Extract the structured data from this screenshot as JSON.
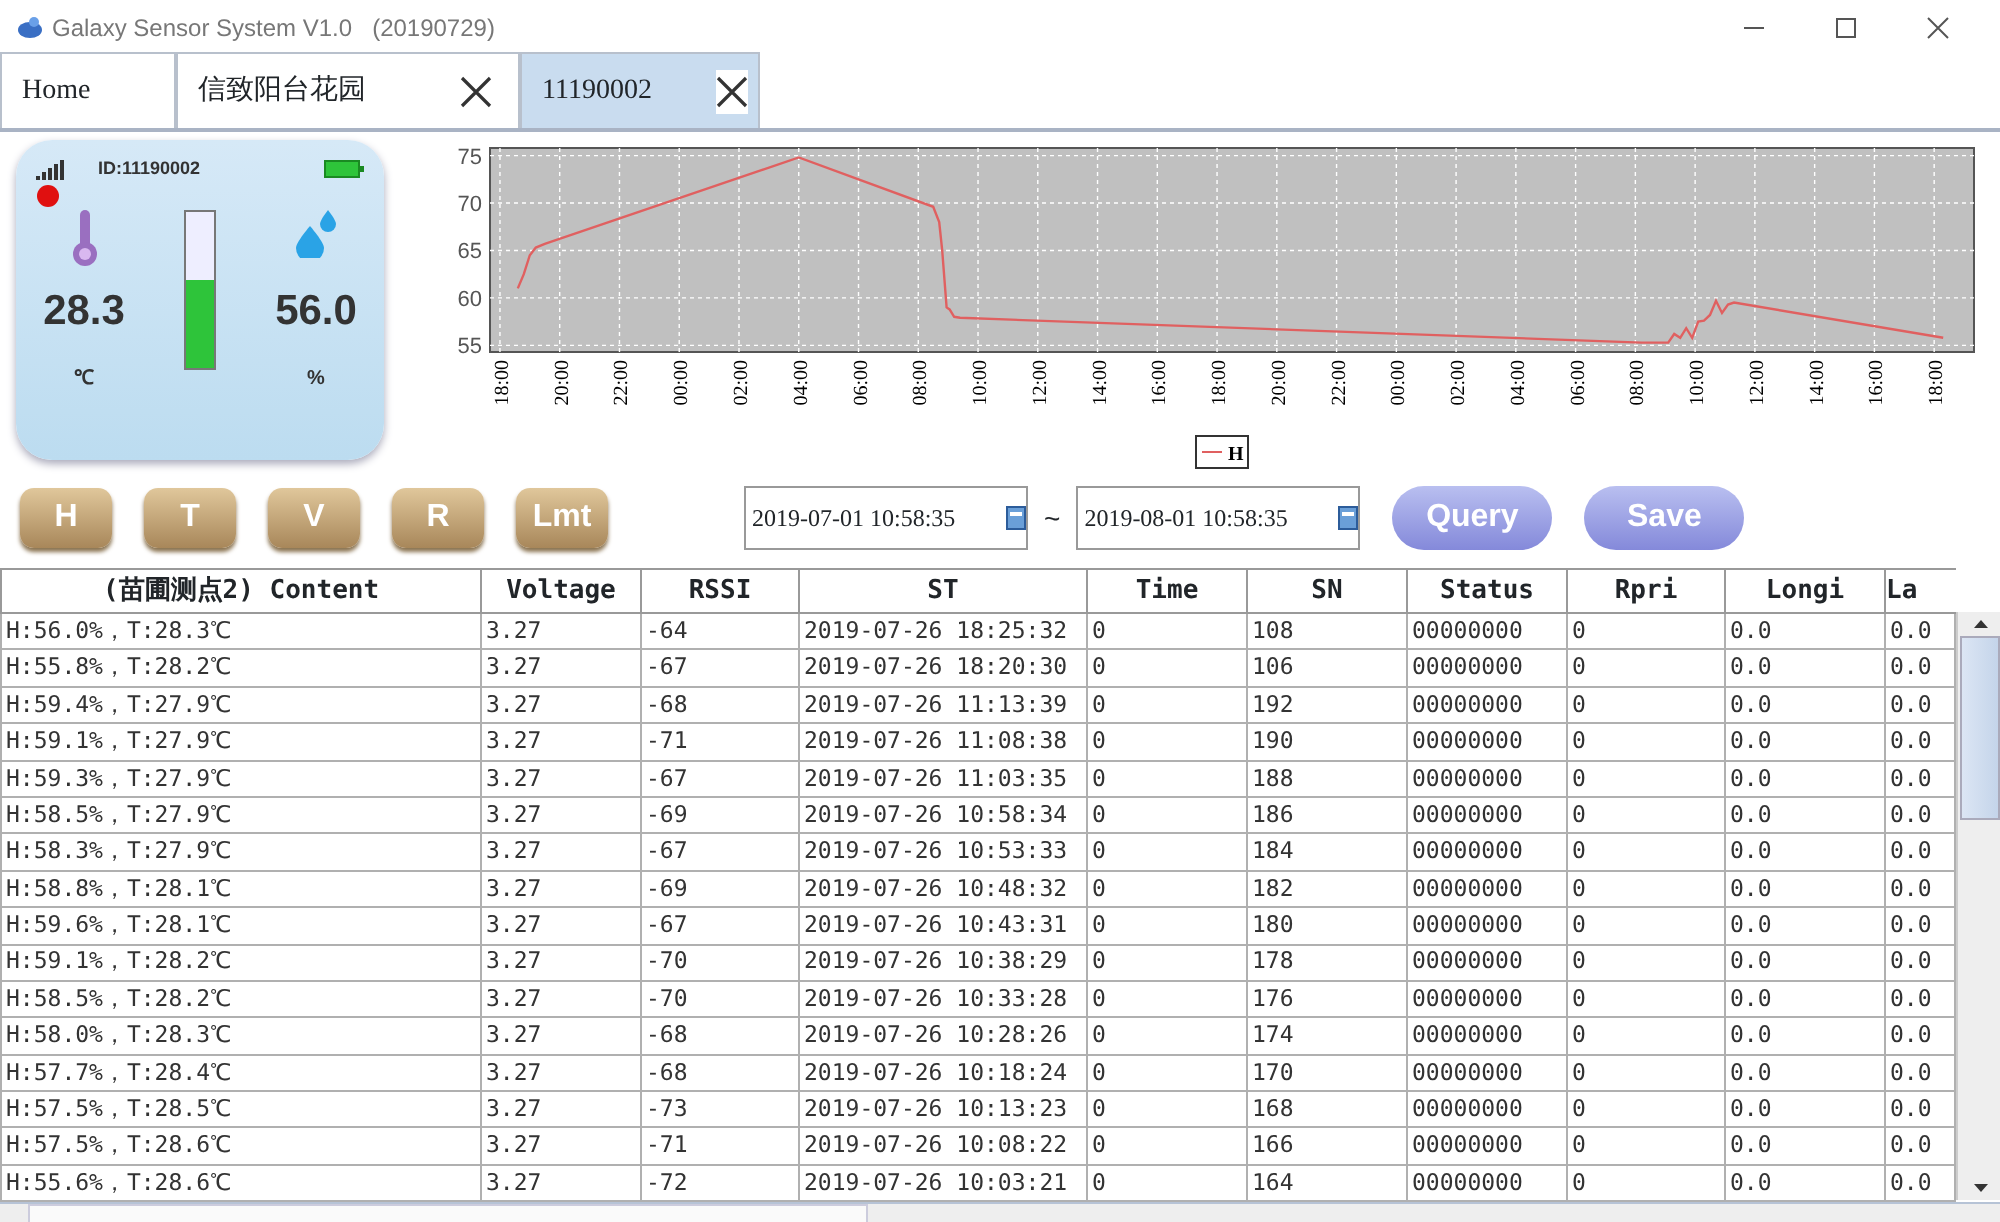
{
  "window": {
    "title": "Galaxy Sensor System V1.0   (20190729)"
  },
  "tabs": [
    {
      "label": "Home",
      "selected": false,
      "closable": false
    },
    {
      "label": "信致阳台花园",
      "selected": false,
      "closable": true
    },
    {
      "label": "11190002",
      "selected": true,
      "closable": true
    }
  ],
  "device": {
    "id": "ID:11190002",
    "online": true,
    "temperature": "28.3",
    "temperature_unit": "℃",
    "humidity": "56.0",
    "humidity_unit": "%",
    "level": 0.56
  },
  "chart": {
    "chart_data": {
      "type": "line",
      "grid": true,
      "ylim": [
        54.3,
        75.8
      ],
      "xlim": [
        "2019-07-24 17:40",
        "2019-07-26 19:20"
      ],
      "x": [
        "2019-07-24 18:36",
        "2019-07-24 18:48",
        "2019-07-24 19:00",
        "2019-07-24 19:12",
        "2019-07-24 19:30",
        "2019-07-25 04:00",
        "2019-07-25 08:30",
        "2019-07-25 08:42",
        "2019-07-25 08:48",
        "2019-07-25 08:57",
        "2019-07-25 09:03",
        "2019-07-25 09:12",
        "2019-07-25 09:24",
        "2019-07-26 08:12",
        "2019-07-26 09:06",
        "2019-07-26 09:18",
        "2019-07-26 09:30",
        "2019-07-26 09:42",
        "2019-07-26 09:54",
        "2019-07-26 10:06",
        "2019-07-26 10:18",
        "2019-07-26 10:30",
        "2019-07-26 10:42",
        "2019-07-26 10:54",
        "2019-07-26 11:06",
        "2019-07-26 11:18",
        "2019-07-26 18:18"
      ],
      "series": [
        {
          "name": "H",
          "color": "#e06060",
          "values": [
            61,
            62.5,
            64.5,
            65.3,
            65.7,
            74.8,
            69.6,
            68,
            65,
            59,
            58.8,
            58,
            57.9,
            55.3,
            55.3,
            56.2,
            55.8,
            56.8,
            55.8,
            57.5,
            57.6,
            58.2,
            59.7,
            58.4,
            59.3,
            59.5,
            55.8
          ]
        }
      ],
      "xticks": [
        {
          "value": "2019-07-24 18:00",
          "label": "18:00"
        },
        {
          "value": "2019-07-24 20:00",
          "label": "20:00"
        },
        {
          "value": "2019-07-24 22:00",
          "label": "22:00"
        },
        {
          "value": "2019-07-25 00:00",
          "label": "00:00"
        },
        {
          "value": "2019-07-25 02:00",
          "label": "02:00"
        },
        {
          "value": "2019-07-25 04:00",
          "label": "04:00"
        },
        {
          "value": "2019-07-25 06:00",
          "label": "06:00"
        },
        {
          "value": "2019-07-25 08:00",
          "label": "08:00"
        },
        {
          "value": "2019-07-25 10:00",
          "label": "10:00"
        },
        {
          "value": "2019-07-25 12:00",
          "label": "12:00"
        },
        {
          "value": "2019-07-25 14:00",
          "label": "14:00"
        },
        {
          "value": "2019-07-25 16:00",
          "label": "16:00"
        },
        {
          "value": "2019-07-25 18:00",
          "label": "18:00"
        },
        {
          "value": "2019-07-25 20:00",
          "label": "20:00"
        },
        {
          "value": "2019-07-25 22:00",
          "label": "22:00"
        },
        {
          "value": "2019-07-26 00:00",
          "label": "00:00"
        },
        {
          "value": "2019-07-26 02:00",
          "label": "02:00"
        },
        {
          "value": "2019-07-26 04:00",
          "label": "04:00"
        },
        {
          "value": "2019-07-26 06:00",
          "label": "06:00"
        },
        {
          "value": "2019-07-26 08:00",
          "label": "08:00"
        },
        {
          "value": "2019-07-26 10:00",
          "label": "10:00"
        },
        {
          "value": "2019-07-26 12:00",
          "label": "12:00"
        },
        {
          "value": "2019-07-26 14:00",
          "label": "14:00"
        },
        {
          "value": "2019-07-26 16:00",
          "label": "16:00"
        },
        {
          "value": "2019-07-26 18:00",
          "label": "18:00"
        }
      ],
      "yticks": [
        55,
        60,
        65,
        70,
        75
      ]
    }
  },
  "mode_buttons": [
    "H",
    "T",
    "V",
    "R",
    "Lmt"
  ],
  "query": {
    "start": "2019-07-01 10:58:35",
    "separator": "~",
    "end": "2019-08-01 10:58:35",
    "buttons": [
      "Query",
      "Save"
    ]
  },
  "table": {
    "columns": [
      "(苗圃测点2) Content",
      "Voltage",
      "RSSI",
      "ST",
      "Time",
      "SN",
      "Status",
      "Rpri",
      "Longi",
      "La"
    ],
    "rows": [
      [
        "H:56.0%，T:28.3℃",
        "3.27",
        "-64",
        "2019-07-26 18:25:32",
        "0",
        "108",
        "00000000",
        "0",
        "0.0",
        "0.0"
      ],
      [
        "H:55.8%，T:28.2℃",
        "3.27",
        "-67",
        "2019-07-26 18:20:30",
        "0",
        "106",
        "00000000",
        "0",
        "0.0",
        "0.0"
      ],
      [
        "H:59.4%，T:27.9℃",
        "3.27",
        "-68",
        "2019-07-26 11:13:39",
        "0",
        "192",
        "00000000",
        "0",
        "0.0",
        "0.0"
      ],
      [
        "H:59.1%，T:27.9℃",
        "3.27",
        "-71",
        "2019-07-26 11:08:38",
        "0",
        "190",
        "00000000",
        "0",
        "0.0",
        "0.0"
      ],
      [
        "H:59.3%，T:27.9℃",
        "3.27",
        "-67",
        "2019-07-26 11:03:35",
        "0",
        "188",
        "00000000",
        "0",
        "0.0",
        "0.0"
      ],
      [
        "H:58.5%，T:27.9℃",
        "3.27",
        "-69",
        "2019-07-26 10:58:34",
        "0",
        "186",
        "00000000",
        "0",
        "0.0",
        "0.0"
      ],
      [
        "H:58.3%，T:27.9℃",
        "3.27",
        "-67",
        "2019-07-26 10:53:33",
        "0",
        "184",
        "00000000",
        "0",
        "0.0",
        "0.0"
      ],
      [
        "H:58.8%，T:28.1℃",
        "3.27",
        "-69",
        "2019-07-26 10:48:32",
        "0",
        "182",
        "00000000",
        "0",
        "0.0",
        "0.0"
      ],
      [
        "H:59.6%，T:28.1℃",
        "3.27",
        "-67",
        "2019-07-26 10:43:31",
        "0",
        "180",
        "00000000",
        "0",
        "0.0",
        "0.0"
      ],
      [
        "H:59.1%，T:28.2℃",
        "3.27",
        "-70",
        "2019-07-26 10:38:29",
        "0",
        "178",
        "00000000",
        "0",
        "0.0",
        "0.0"
      ],
      [
        "H:58.5%，T:28.2℃",
        "3.27",
        "-70",
        "2019-07-26 10:33:28",
        "0",
        "176",
        "00000000",
        "0",
        "0.0",
        "0.0"
      ],
      [
        "H:58.0%，T:28.3℃",
        "3.27",
        "-68",
        "2019-07-26 10:28:26",
        "0",
        "174",
        "00000000",
        "0",
        "0.0",
        "0.0"
      ],
      [
        "H:57.7%，T:28.4℃",
        "3.27",
        "-68",
        "2019-07-26 10:18:24",
        "0",
        "170",
        "00000000",
        "0",
        "0.0",
        "0.0"
      ],
      [
        "H:57.5%，T:28.5℃",
        "3.27",
        "-73",
        "2019-07-26 10:13:23",
        "0",
        "168",
        "00000000",
        "0",
        "0.0",
        "0.0"
      ],
      [
        "H:57.5%，T:28.6℃",
        "3.27",
        "-71",
        "2019-07-26 10:08:22",
        "0",
        "166",
        "00000000",
        "0",
        "0.0",
        "0.0"
      ],
      [
        "H:55.6%，T:28.6℃",
        "3.27",
        "-72",
        "2019-07-26 10:03:21",
        "0",
        "164",
        "00000000",
        "0",
        "0.0",
        "0.0"
      ]
    ]
  }
}
